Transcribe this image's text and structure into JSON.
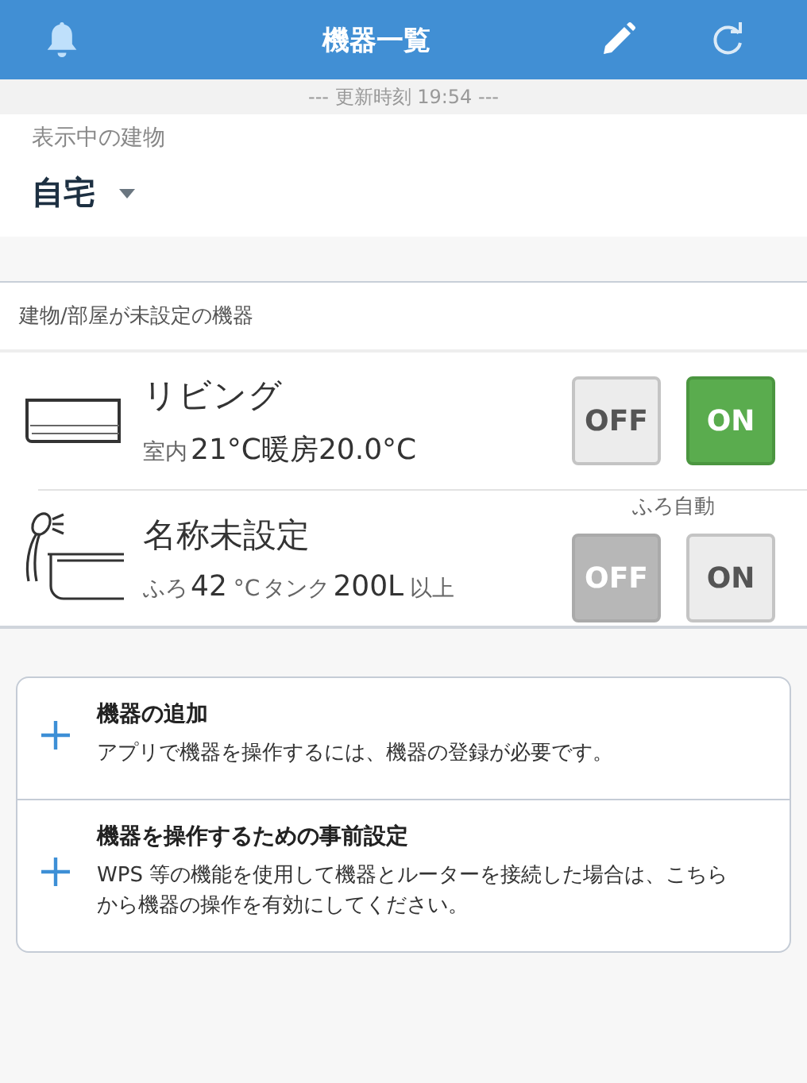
{
  "header": {
    "title": "機器一覧"
  },
  "update_time": "--- 更新時刻 19:54 ---",
  "building": {
    "label": "表示中の建物",
    "value": "自宅"
  },
  "section_title": "建物/部屋が未設定の機器",
  "devices": [
    {
      "kind": "aircon",
      "name": "リビング",
      "status": [
        {
          "text": "室内",
          "emphasis": false
        },
        {
          "text": "21°C暖房20.0°C",
          "emphasis": true
        }
      ],
      "buttons": [
        {
          "label": "OFF",
          "selected": false
        },
        {
          "label": "ON",
          "selected": true
        }
      ]
    },
    {
      "kind": "bath",
      "name": "名称未設定",
      "control_label": "ふろ自動",
      "status": [
        {
          "text": "ふろ",
          "emphasis": false
        },
        {
          "text": "42",
          "emphasis": true
        },
        {
          "text": "°C",
          "emphasis": false
        },
        {
          "text": "タンク",
          "emphasis": false
        },
        {
          "text": "200L",
          "emphasis": true
        },
        {
          "text": "以上",
          "emphasis": false
        }
      ],
      "buttons": [
        {
          "label": "OFF",
          "selected": true
        },
        {
          "label": "ON",
          "selected": false
        }
      ]
    }
  ],
  "actions": [
    {
      "title": "機器の追加",
      "description": "アプリで機器を操作するには、機器の登録が必要です。"
    },
    {
      "title": "機器を操作するための事前設定",
      "description": "WPS 等の機能を使用して機器とルーターを接続した場合は、こちらから機器の操作を有効にしてください。"
    }
  ]
}
